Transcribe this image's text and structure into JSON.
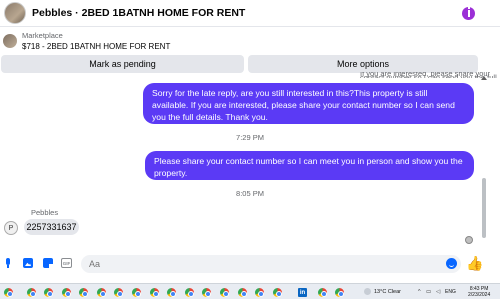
{
  "header": {
    "title": "Pebbles · 2BED 1BATNH HOME FOR RENT",
    "info_icon": "info-icon"
  },
  "marketplace": {
    "label": "Marketplace",
    "listing": "$718 - 2BED 1BATNH HOME FOR RENT"
  },
  "actions": {
    "mark_pending": "Mark as pending",
    "more_options": "More options"
  },
  "conversation": {
    "clipped_text": "If you are interested, please share your contact number so I can send you the full details. Thank you.",
    "messages": [
      {
        "direction": "outgoing",
        "text": "Sorry for the late reply, are you still interested in this?This property is still available. If you are interested, please share your contact number so I can send you the full details. Thank you."
      },
      {
        "timestamp": "7:29 PM"
      },
      {
        "direction": "outgoing",
        "text": "Please share your contact number so I can meet you in person and show you the property."
      },
      {
        "timestamp": "8:05 PM"
      },
      {
        "direction": "incoming",
        "sender": "Pebbles",
        "avatar_alt": "P",
        "text": "2257331637"
      }
    ]
  },
  "compose": {
    "placeholder": "Aa",
    "icons": [
      "microphone-icon",
      "photo-icon",
      "sticker-icon",
      "gif-icon",
      "emoji-icon",
      "thumbs-up-icon"
    ],
    "gif_label": "GIF"
  },
  "taskbar": {
    "weather": "13°C  Clear",
    "language": "ENG",
    "time": "8:43 PM",
    "date": "2/23/2024",
    "linkedin_label": "in",
    "colors": {
      "accent": "#5b3af5",
      "brand_blue": "#0866ff"
    }
  }
}
